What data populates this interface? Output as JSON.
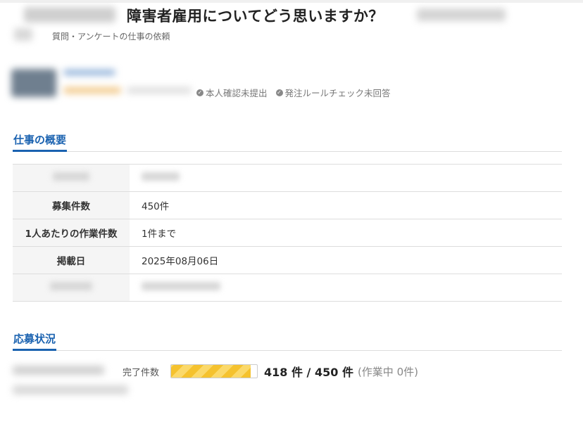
{
  "job": {
    "title": "障害者雇用についてどう思いますか？",
    "category": "質問・アンケートの仕事の依頼"
  },
  "client": {
    "badges": [
      "本人確認未提出",
      "発注ルールチェック未回答"
    ]
  },
  "overview": {
    "heading": "仕事の概要",
    "rows": [
      {
        "label": "募集件数",
        "value": "450件"
      },
      {
        "label": "1人あたりの作業件数",
        "value": "1件まで"
      },
      {
        "label": "掲載日",
        "value": "2025年08月06日"
      }
    ]
  },
  "application": {
    "heading": "応募状況",
    "completed_label": "完了件数",
    "count_text": "418 件 / 450 件",
    "working_text": "(作業中 0件)",
    "progress": {
      "completed": 418,
      "total": 450
    }
  },
  "colors": {
    "accent": "#1a62b0",
    "progress": "#f5c22e"
  }
}
